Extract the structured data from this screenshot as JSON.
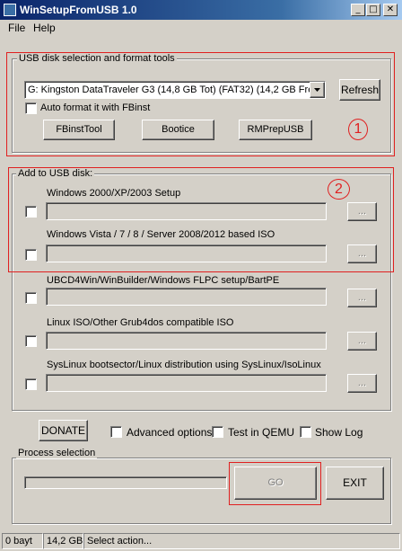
{
  "window": {
    "title": "WinSetupFromUSB 1.0",
    "min_glyph": "_",
    "max_glyph": "□",
    "close_glyph": "✕"
  },
  "menu": {
    "file": "File",
    "help": "Help"
  },
  "usb_group": {
    "label": "USB disk selection and format tools",
    "disk_value": "G: Kingston DataTraveler G3 (14,8 GB Tot) (FAT32) (14,2 GB Free",
    "refresh": "Refresh",
    "auto_format": "Auto format it with FBinst",
    "fbinsttool": "FBinstTool",
    "bootice": "Bootice",
    "rmprepusb": "RMPrepUSB",
    "marker": "1"
  },
  "add_group": {
    "label": "Add to USB disk:",
    "marker": "2",
    "browse": "...",
    "items": [
      {
        "label": "Windows 2000/XP/2003 Setup"
      },
      {
        "label": "Windows Vista / 7 / 8 / Server 2008/2012 based ISO"
      },
      {
        "label": "UBCD4Win/WinBuilder/Windows FLPC setup/BartPE"
      },
      {
        "label": "Linux ISO/Other Grub4dos compatible ISO"
      },
      {
        "label": "SysLinux bootsector/Linux distribution using SysLinux/IsoLinux"
      }
    ]
  },
  "options": {
    "donate": "DONATE",
    "advanced": "Advanced options",
    "qemu": "Test in QEMU",
    "log": "Show Log"
  },
  "process": {
    "label": "Process selection",
    "go": "GO",
    "exit": "EXIT"
  },
  "statusbar": {
    "size": "0 bayt",
    "free": "14,2 GB",
    "action": "Select action..."
  },
  "colors": {
    "title_start": "#0a246a",
    "title_end": "#a6caf0",
    "annotation": "#e02020",
    "face": "#d4d0c8"
  }
}
